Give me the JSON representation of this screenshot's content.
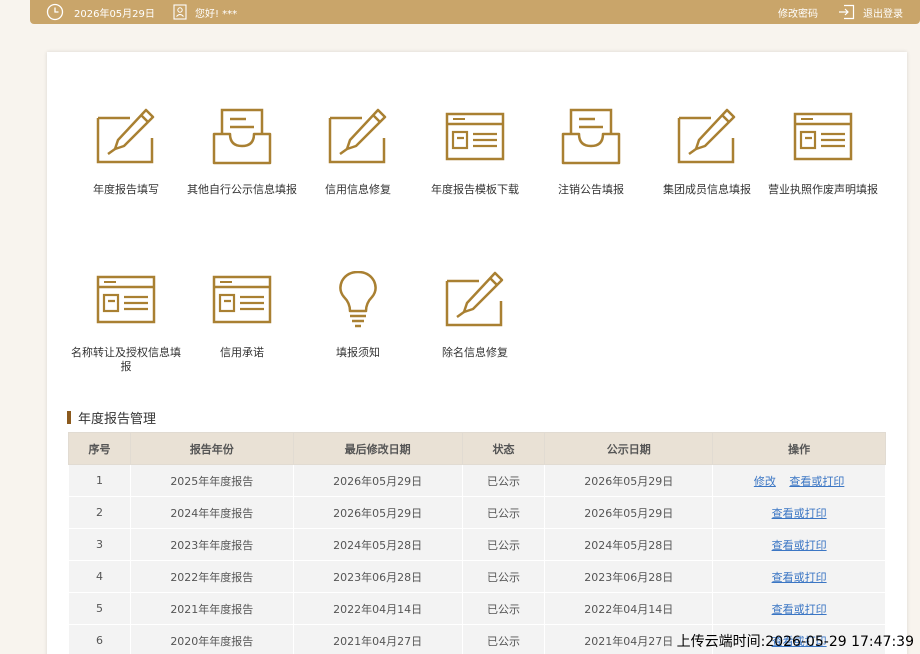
{
  "topbar": {
    "date": "2026年05月29日",
    "greeting": "您好! ***",
    "change_password": "修改密码",
    "logout": "退出登录",
    "bg_color": "#c9a56a"
  },
  "tiles": [
    {
      "label": "年度报告填写",
      "icon": "edit-icon"
    },
    {
      "label": "其他自行公示信息填报",
      "icon": "inbox-icon"
    },
    {
      "label": "信用信息修复",
      "icon": "edit-icon"
    },
    {
      "label": "年度报告模板下载",
      "icon": "template-icon"
    },
    {
      "label": "注销公告填报",
      "icon": "inbox-icon"
    },
    {
      "label": "集团成员信息填报",
      "icon": "edit-icon"
    },
    {
      "label": "营业执照作废声明填报",
      "icon": "template-icon"
    },
    {
      "label": "名称转让及授权信息填报",
      "icon": "template-icon"
    },
    {
      "label": "信用承诺",
      "icon": "template-icon"
    },
    {
      "label": "填报须知",
      "icon": "lightbulb-icon"
    },
    {
      "label": "除名信息修复",
      "icon": "edit-icon"
    }
  ],
  "section": {
    "title": "年度报告管理"
  },
  "table": {
    "headers": [
      "序号",
      "报告年份",
      "最后修改日期",
      "状态",
      "公示日期",
      "操作"
    ],
    "rows": [
      {
        "no": "1",
        "year": "2025年年度报告",
        "modified": "2026年05月29日",
        "status": "已公示",
        "published": "2026年05月29日",
        "edit": "修改",
        "view": "查看或打印"
      },
      {
        "no": "2",
        "year": "2024年年度报告",
        "modified": "2026年05月29日",
        "status": "已公示",
        "published": "2026年05月29日",
        "edit": "",
        "view": "查看或打印"
      },
      {
        "no": "3",
        "year": "2023年年度报告",
        "modified": "2024年05月28日",
        "status": "已公示",
        "published": "2024年05月28日",
        "edit": "",
        "view": "查看或打印"
      },
      {
        "no": "4",
        "year": "2022年年度报告",
        "modified": "2023年06月28日",
        "status": "已公示",
        "published": "2023年06月28日",
        "edit": "",
        "view": "查看或打印"
      },
      {
        "no": "5",
        "year": "2021年年度报告",
        "modified": "2022年04月14日",
        "status": "已公示",
        "published": "2022年04月14日",
        "edit": "",
        "view": "查看或打印"
      },
      {
        "no": "6",
        "year": "2020年年度报告",
        "modified": "2021年04月27日",
        "status": "已公示",
        "published": "2021年04月27日",
        "edit": "",
        "view": "查看或打印"
      }
    ]
  },
  "watermark": "上传云端时间:2026-05-29 17:47:39",
  "colors": {
    "accent": "#a98032",
    "link": "#3b76c4",
    "header_bg": "#e9e1d5"
  }
}
